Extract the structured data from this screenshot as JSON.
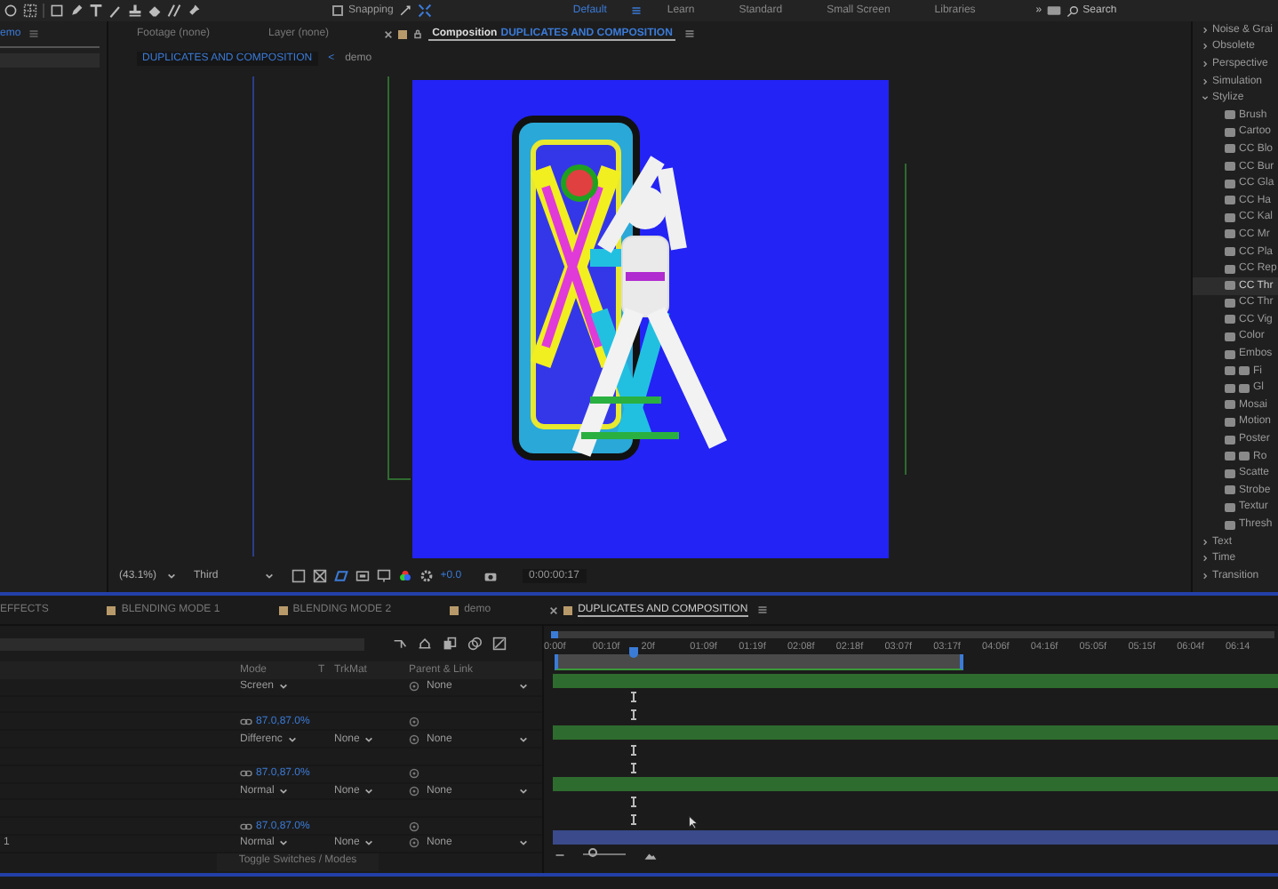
{
  "toolbar": {
    "snapping": {
      "label": "Snapping",
      "checked": false
    },
    "workspaces": [
      {
        "label": "Default",
        "selected": true
      },
      {
        "label": "Learn",
        "selected": false
      },
      {
        "label": "Standard",
        "selected": false
      },
      {
        "label": "Small Screen",
        "selected": false
      },
      {
        "label": "Libraries",
        "selected": false
      }
    ],
    "overflow": "»",
    "search": {
      "placeholder": "Search"
    }
  },
  "project_panel": {
    "tab": "emo"
  },
  "viewer": {
    "tabs": [
      {
        "label": "Footage (none)",
        "selected": false
      },
      {
        "label": "Layer (none)",
        "selected": false
      },
      {
        "label": "Composition",
        "name": "DUPLICATES AND COMPOSITION",
        "selected": true
      }
    ],
    "breadcrumbs": [
      {
        "label": "DUPLICATES AND COMPOSITION",
        "selected": true
      },
      {
        "label": "demo",
        "selected": false
      }
    ],
    "breadcrumb_separator": "<",
    "zoom": "(43.1%)",
    "resolution": "Third",
    "exposure": "+0.0",
    "timecode": "0:00:00:17"
  },
  "effects_panel": {
    "items": [
      {
        "label": "Noise & Grai",
        "expanded": false
      },
      {
        "label": "Obsolete",
        "expanded": false
      },
      {
        "label": "Perspective",
        "expanded": false
      },
      {
        "label": "Simulation",
        "expanded": false
      },
      {
        "label": "Stylize",
        "expanded": true,
        "children": [
          {
            "label": "Brush",
            "kind": "standard",
            "selected": false
          },
          {
            "label": "Cartoo",
            "kind": "standard",
            "selected": false
          },
          {
            "label": "CC Blo",
            "kind": "standard",
            "selected": false
          },
          {
            "label": "CC Bur",
            "kind": "standard",
            "selected": false
          },
          {
            "label": "CC Gla",
            "kind": "standard",
            "selected": false
          },
          {
            "label": "CC Ha",
            "kind": "standard",
            "selected": false
          },
          {
            "label": "CC Kal",
            "kind": "standard",
            "selected": false
          },
          {
            "label": "CC Mr",
            "kind": "standard",
            "selected": false
          },
          {
            "label": "CC Pla",
            "kind": "standard",
            "selected": false
          },
          {
            "label": "CC Rep",
            "kind": "standard",
            "selected": false
          },
          {
            "label": "CC Thr",
            "kind": "standard",
            "selected": true
          },
          {
            "label": "CC Thr",
            "kind": "standard",
            "selected": false
          },
          {
            "label": "CC Vig",
            "kind": "standard",
            "selected": false
          },
          {
            "label": "Color",
            "kind": "standard",
            "selected": false
          },
          {
            "label": "Embos",
            "kind": "standard",
            "selected": false
          },
          {
            "label": "Fi",
            "kind": "accelerated",
            "selected": false
          },
          {
            "label": "Gl",
            "kind": "accelerated",
            "selected": false
          },
          {
            "label": "Mosai",
            "kind": "standard",
            "selected": false
          },
          {
            "label": "Motion",
            "kind": "standard",
            "selected": false
          },
          {
            "label": "Poster",
            "kind": "standard",
            "selected": false
          },
          {
            "label": "Ro",
            "kind": "accelerated",
            "selected": false
          },
          {
            "label": "Scatte",
            "kind": "standard",
            "selected": false
          },
          {
            "label": "Strobe",
            "kind": "standard",
            "selected": false
          },
          {
            "label": "Textur",
            "kind": "standard",
            "selected": false
          },
          {
            "label": "Thresh",
            "kind": "standard",
            "selected": false
          }
        ]
      },
      {
        "label": "Text",
        "expanded": false
      },
      {
        "label": "Time",
        "expanded": false
      },
      {
        "label": "Transition",
        "expanded": false
      }
    ]
  },
  "timeline": {
    "tabs": [
      {
        "label": "EFFECTS",
        "selected": false
      },
      {
        "label": "BLENDING MODE 1",
        "selected": false
      },
      {
        "label": "BLENDING MODE 2",
        "selected": false
      },
      {
        "label": "demo",
        "selected": false
      },
      {
        "label": "DUPLICATES AND COMPOSITION",
        "selected": true
      }
    ],
    "columns": [
      "Mode",
      "T",
      "TrkMat",
      "Parent & Link"
    ],
    "rows": [
      {
        "kind": "layer",
        "mode": "Screen",
        "parent": "None",
        "color": "#2e6b2e"
      },
      {
        "kind": "property"
      },
      {
        "kind": "scale",
        "value": "87.0,87.0%"
      },
      {
        "kind": "layer",
        "mode": "Differenc",
        "trkmat": "None",
        "parent": "None",
        "color": "#2e6b2e"
      },
      {
        "kind": "property"
      },
      {
        "kind": "scale",
        "value": "87.0,87.0%"
      },
      {
        "kind": "layer",
        "mode": "Normal",
        "trkmat": "None",
        "parent": "None",
        "color": "#2e6b2e"
      },
      {
        "kind": "property"
      },
      {
        "kind": "scale",
        "value": "87.0,87.0%"
      },
      {
        "kind": "layer",
        "index": "1",
        "mode": "Normal",
        "trkmat": "None",
        "parent": "None",
        "color": "#3a4a8a"
      }
    ],
    "toggle": "Toggle Switches / Modes",
    "zoom_slider": {
      "level": 0.2
    },
    "ruler": [
      "0:00f",
      "00:10f",
      "20f",
      "01:09f",
      "01:19f",
      "02:08f",
      "02:18f",
      "03:07f",
      "03:17f",
      "04:06f",
      "04:16f",
      "05:05f",
      "05:15f",
      "06:04f",
      "06:14"
    ]
  }
}
